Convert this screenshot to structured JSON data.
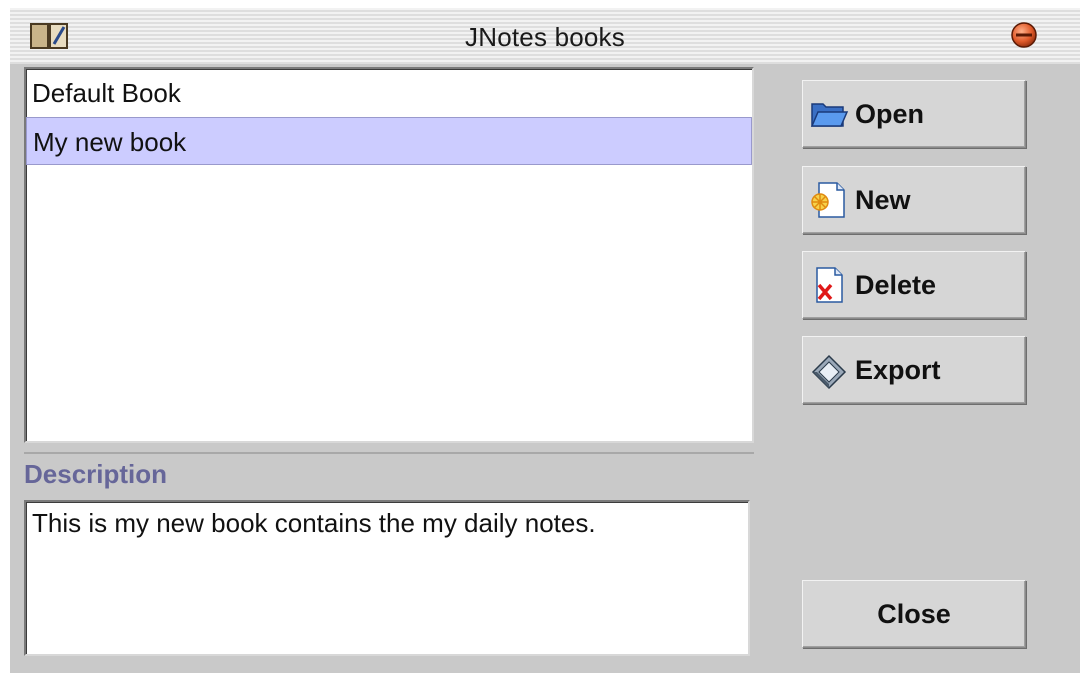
{
  "window": {
    "title": "JNotes books"
  },
  "books": {
    "items": [
      {
        "label": "Default Book",
        "selected": false
      },
      {
        "label": "My new book",
        "selected": true
      }
    ]
  },
  "description": {
    "header": "Description",
    "text": "This is my new book contains the my daily notes."
  },
  "buttons": {
    "open": {
      "label": "Open",
      "icon": "folder-open-icon"
    },
    "new": {
      "label": "New",
      "icon": "new-document-icon"
    },
    "delete": {
      "label": "Delete",
      "icon": "delete-document-icon"
    },
    "export": {
      "label": "Export",
      "icon": "export-disk-icon"
    },
    "close": {
      "label": "Close"
    }
  },
  "colors": {
    "selection": "#ccccff",
    "description_header": "#666699",
    "panel_background": "#c9c9c9",
    "close_button": "#e05a2a"
  }
}
